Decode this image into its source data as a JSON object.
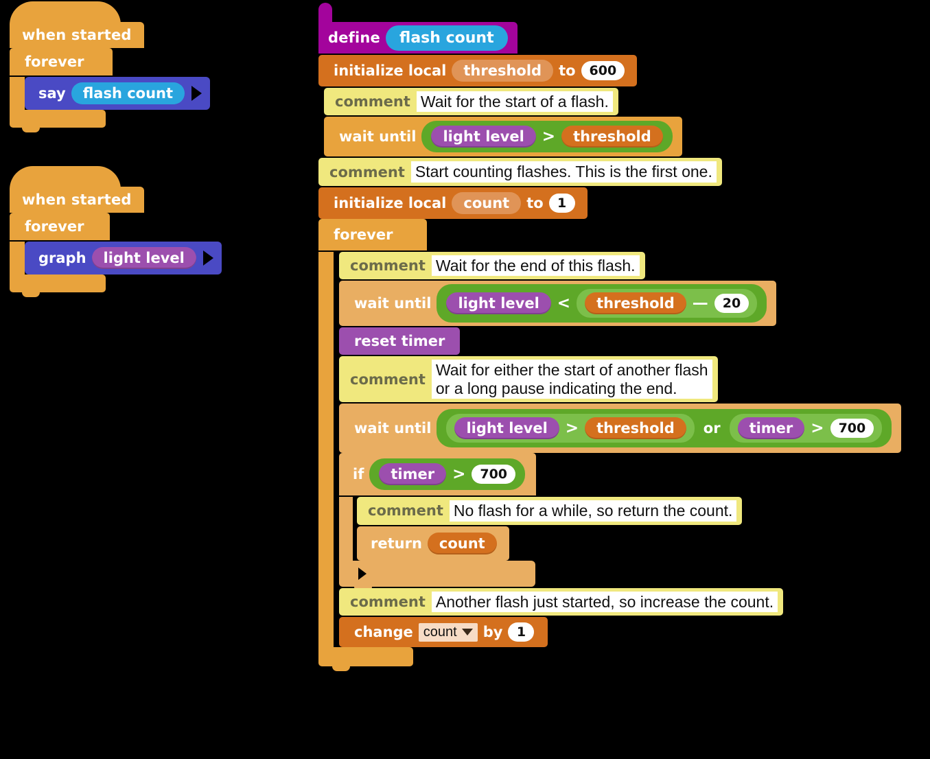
{
  "palette": {
    "control": "#E8A33D",
    "control_light": "#E9AE62",
    "variables": "#D4701E",
    "variables_light": "#E09457",
    "looks": "#4A4AC4",
    "sensing": "#9C4FAE",
    "operators": "#5EA828",
    "operators_light": "#7CBF4A",
    "comment": "#F0E87E",
    "define": "#A3049C",
    "custom_block": "#29A5DE",
    "canvas": "#000000"
  },
  "scripts": [
    {
      "id": "script-say-flash-count",
      "hat": "when started",
      "loop": "forever",
      "body": {
        "command": "say",
        "argument": "flash count",
        "has_expand_arrow": true
      }
    },
    {
      "id": "script-graph-light-level",
      "hat": "when started",
      "loop": "forever",
      "body": {
        "command": "graph",
        "argument": "light level",
        "has_expand_arrow": true
      }
    }
  ],
  "definition": {
    "define_label": "define",
    "block_name": "flash count",
    "statements": {
      "init_threshold": {
        "label": "initialize local",
        "variable": "threshold",
        "to_label": "to",
        "value": "600"
      },
      "comment_wait_start": "Wait for the start of a flash.",
      "wait_until_1": {
        "label": "wait until",
        "left": "light level",
        "operator": ">",
        "right": "threshold"
      },
      "comment_start_counting": "Start counting flashes. This is the first one.",
      "init_count": {
        "label": "initialize local",
        "variable": "count",
        "to_label": "to",
        "value": "1"
      },
      "forever_label": "forever",
      "comment_wait_end": "Wait for the end of this flash.",
      "wait_until_2": {
        "label": "wait until",
        "left": "light level",
        "operator": "<",
        "right_left": "threshold",
        "right_operator": "—",
        "right_value": "20"
      },
      "reset_timer": "reset timer",
      "comment_wait_either": "Wait for either the start of another flash\nor a long pause indicating the end.",
      "wait_until_3": {
        "label": "wait until",
        "a_left": "light level",
        "a_operator": ">",
        "a_right": "threshold",
        "join_operator": "or",
        "b_left": "timer",
        "b_operator": ">",
        "b_right": "700"
      },
      "if_block": {
        "label": "if",
        "cond_left": "timer",
        "cond_operator": ">",
        "cond_right": "700",
        "comment_no_flash": "No flash for a while, so return the count.",
        "return_label": "return",
        "return_value": "count"
      },
      "comment_another_flash": "Another flash just started, so increase the count.",
      "change_block": {
        "label": "change",
        "variable": "count",
        "by_label": "by",
        "value": "1"
      }
    }
  },
  "icons": {
    "expand_arrow": "right-triangle-arrow-icon",
    "dropdown_caret": "chevron-down-icon"
  }
}
